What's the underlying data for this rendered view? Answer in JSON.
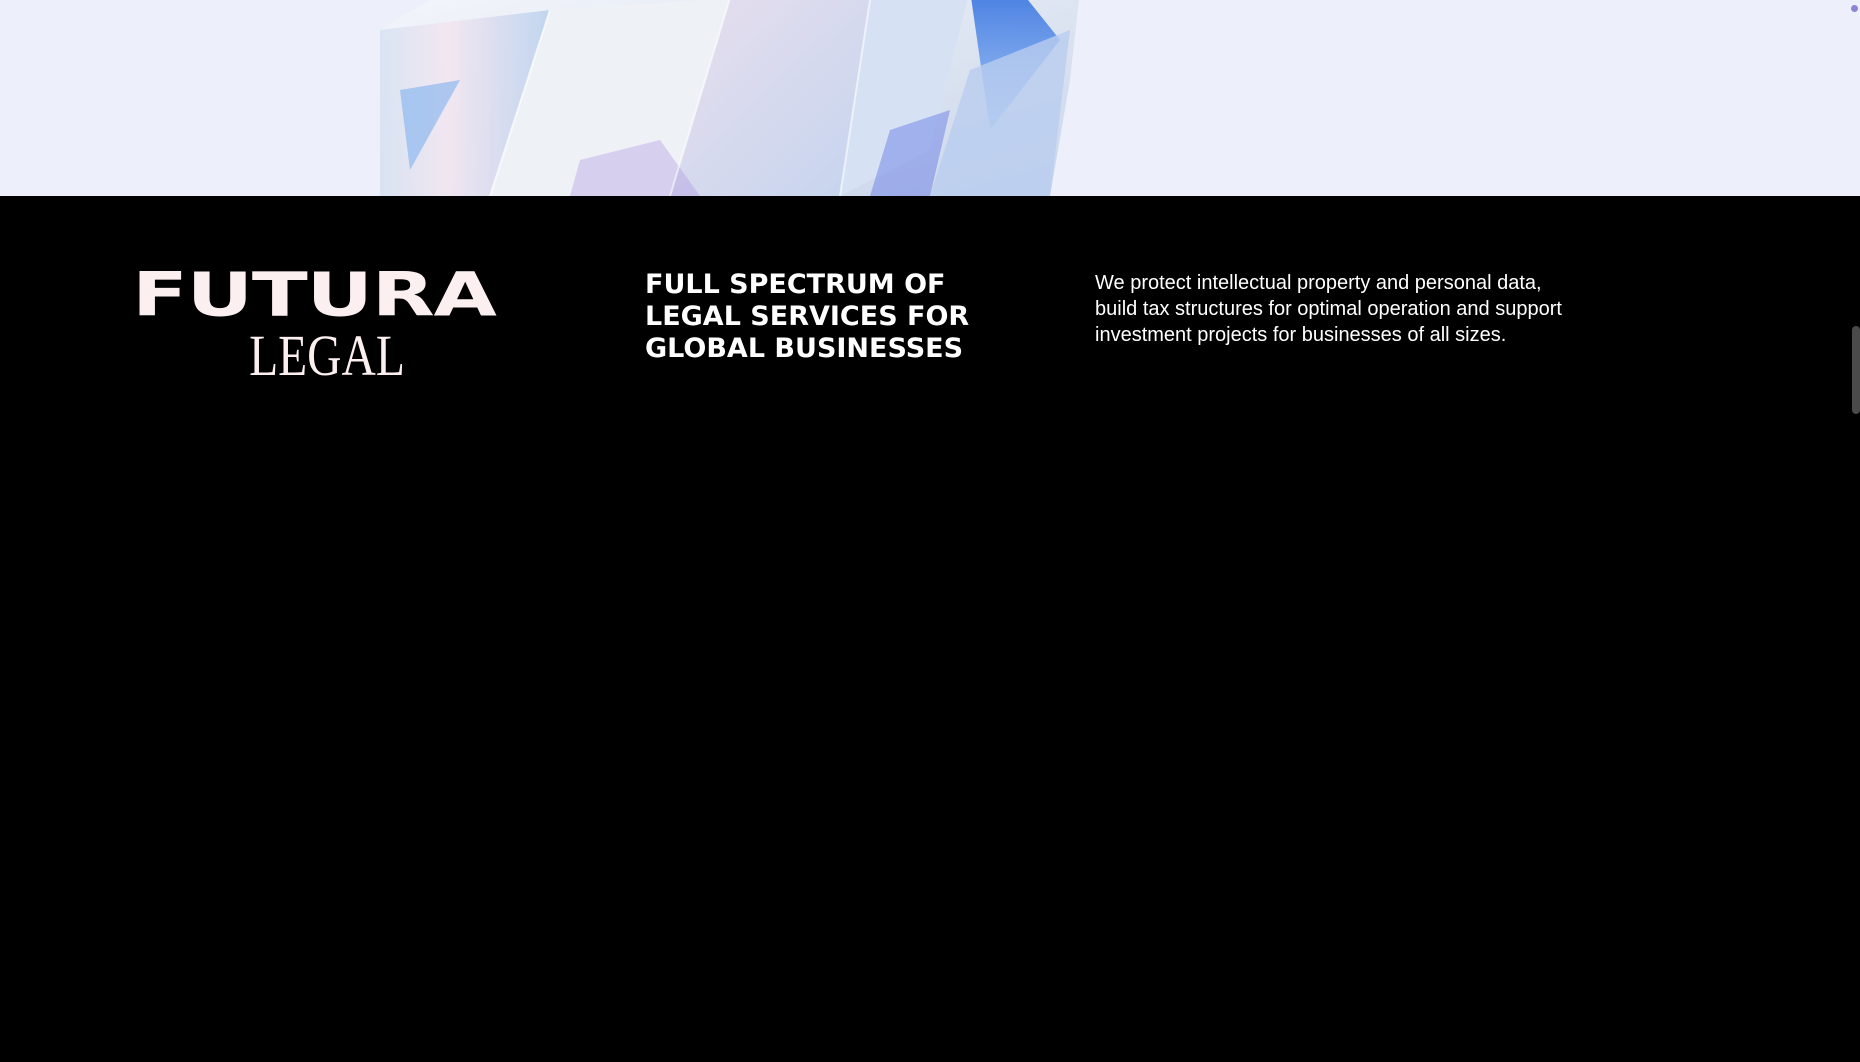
{
  "hero": {
    "image": "crystal-diamond-render"
  },
  "footer": {
    "logo": {
      "line1": "FUTURA",
      "line2": "LEGAL"
    },
    "tagline": "FULL SPECTRUM OF LEGAL SERVICES FOR GLOBAL BUSINESSES",
    "description": "We protect intellectual property and personal data, build tax structures for optimal operation and support investment projects for businesses of all sizes."
  },
  "colors": {
    "hero_background": "#edf0fb",
    "footer_background": "#000000",
    "logo_color": "#fbeff0",
    "text_color": "#ffffff"
  }
}
